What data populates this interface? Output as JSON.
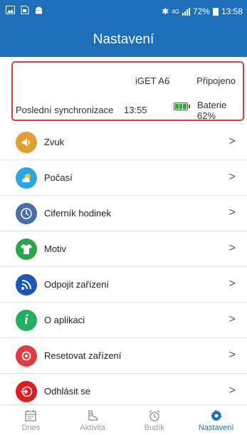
{
  "status_bar": {
    "right_text": "✱ ⁴ᴳ .∡∡ 72%",
    "network": "4G",
    "battery": "72%",
    "time": "13:58",
    "icons": [
      "image-icon",
      "sim-icon",
      "android-icon",
      "bluetooth-icon",
      "signal-icon",
      "battery-icon"
    ]
  },
  "header": {
    "title": "Nastavení"
  },
  "device": {
    "name": "iGET A6",
    "status": "Připojeno",
    "sync_label": "Poslední synchronizace",
    "sync_time": "13:55",
    "battery_label": "Baterie  62%",
    "battery_level": 0.62
  },
  "items": [
    {
      "label": "Zvuk",
      "icon": "speaker-icon",
      "color": "#e0a030"
    },
    {
      "label": "Počasí",
      "icon": "weather-icon",
      "color": "#2aa6e8"
    },
    {
      "label": "Ciferník hodinek",
      "icon": "clock-icon",
      "color": "#4b6ea8"
    },
    {
      "label": "Motiv",
      "icon": "shirt-icon",
      "color": "#2aa64a"
    },
    {
      "label": "Odpojit zařízení",
      "icon": "signal-wave-icon",
      "color": "#1c56b8"
    },
    {
      "label": "O aplikaci",
      "icon": "info-icon",
      "color": "#22b060"
    },
    {
      "label": "Resetovat zařízení",
      "icon": "reset-icon",
      "color": "#e23b3b"
    },
    {
      "label": "Odhlásit se",
      "icon": "logout-icon",
      "color": "#e21b1b"
    }
  ],
  "chevron": ">",
  "nav": [
    {
      "label": "Dnes",
      "icon": "calendar-icon",
      "active": false
    },
    {
      "label": "Aktivita",
      "icon": "shoe-icon",
      "active": false
    },
    {
      "label": "Budík",
      "icon": "alarm-clock-icon",
      "active": false
    },
    {
      "label": "Nastavení",
      "icon": "gear-icon",
      "active": true
    }
  ],
  "colors": {
    "primary": "#1c6fb8",
    "card_border": "#e23b3b",
    "battery_fill": "#2eaa2e"
  }
}
